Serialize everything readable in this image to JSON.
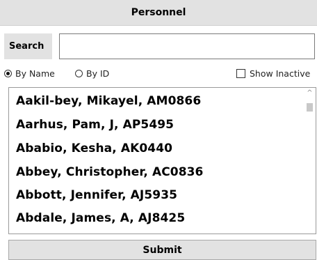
{
  "header": {
    "title": "Personnel"
  },
  "search": {
    "label": "Search",
    "value": "",
    "placeholder": ""
  },
  "options": {
    "by_name": {
      "label": "By Name",
      "selected": true
    },
    "by_id": {
      "label": "By ID",
      "selected": false
    },
    "show_inactive": {
      "label": "Show Inactive",
      "checked": false
    }
  },
  "list": {
    "items": [
      "Aakil-bey, Mikayel, AM0866",
      "Aarhus, Pam, J, AP5495",
      "Ababio, Kesha, AK0440",
      "Abbey, Christopher, AC0836",
      "Abbott, Jennifer, AJ5935",
      "Abdale, James, A, AJ8425"
    ]
  },
  "scrollbar": {
    "up_arrow": "^"
  },
  "submit": {
    "label": "Submit"
  }
}
